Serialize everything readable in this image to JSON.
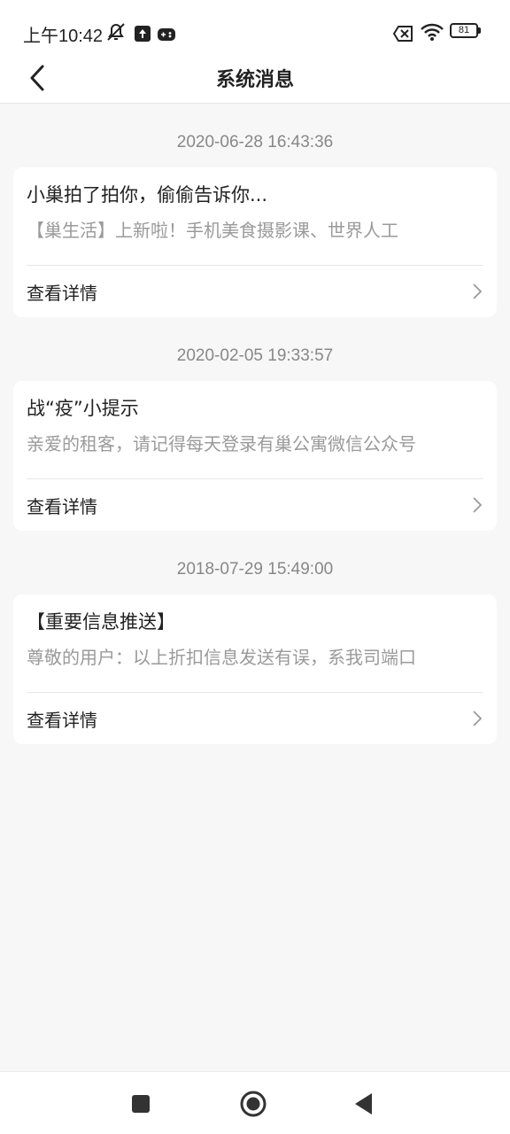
{
  "status_bar": {
    "time": "上午10:42",
    "battery": "81"
  },
  "header": {
    "title": "系统消息"
  },
  "messages": [
    {
      "timestamp": "2020-06-28 16:43:36",
      "title": "小巢拍了拍你，偷偷告诉你...",
      "body": "【巢生活】上新啦！手机美食摄影课、世界人工",
      "action": "查看详情"
    },
    {
      "timestamp": "2020-02-05 19:33:57",
      "title": "战“疫”小提示",
      "body": "亲爱的租客，请记得每天登录有巢公寓微信公众号",
      "action": "查看详情"
    },
    {
      "timestamp": "2018-07-29 15:49:00",
      "title": "【重要信息推送】",
      "body": "尊敬的用户：以上折扣信息发送有误，系我司端口",
      "action": "查看详情"
    }
  ]
}
